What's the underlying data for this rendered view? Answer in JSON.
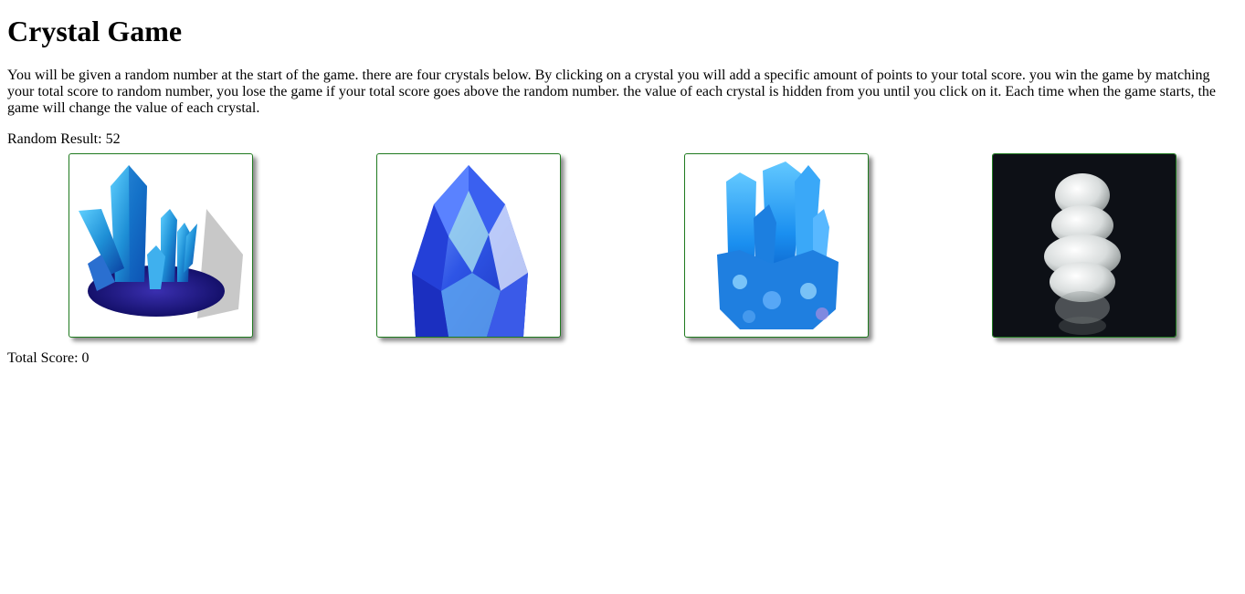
{
  "title": "Crystal Game",
  "instructions": "You will be given a random number at the start of the game. there are four crystals below. By clicking on a crystal you will add a specific amount of points to your total score. you win the game by matching your total score to random number, you lose the game if your total score goes above the random number. the value of each crystal is hidden from you until you click on it. Each time when the game starts, the game will change the value of each crystal.",
  "random_result": {
    "label": "Random Result: ",
    "value": "52"
  },
  "crystals": [
    {
      "icon": "blue-crystal-cluster-icon",
      "accent": "#1e8fd6"
    },
    {
      "icon": "blue-faceted-gem-icon",
      "accent": "#2e55e6"
    },
    {
      "icon": "aqua-crystal-cluster-icon",
      "accent": "#1aa0f0"
    },
    {
      "icon": "clear-quartz-stack-icon",
      "accent": "#d8dcdc"
    }
  ],
  "total_score": {
    "label": "Total Score: ",
    "value": "0"
  },
  "colors": {
    "crystal_border": "#1f7a1f",
    "background": "#ffffff",
    "quartz_background": "#0d1016"
  }
}
